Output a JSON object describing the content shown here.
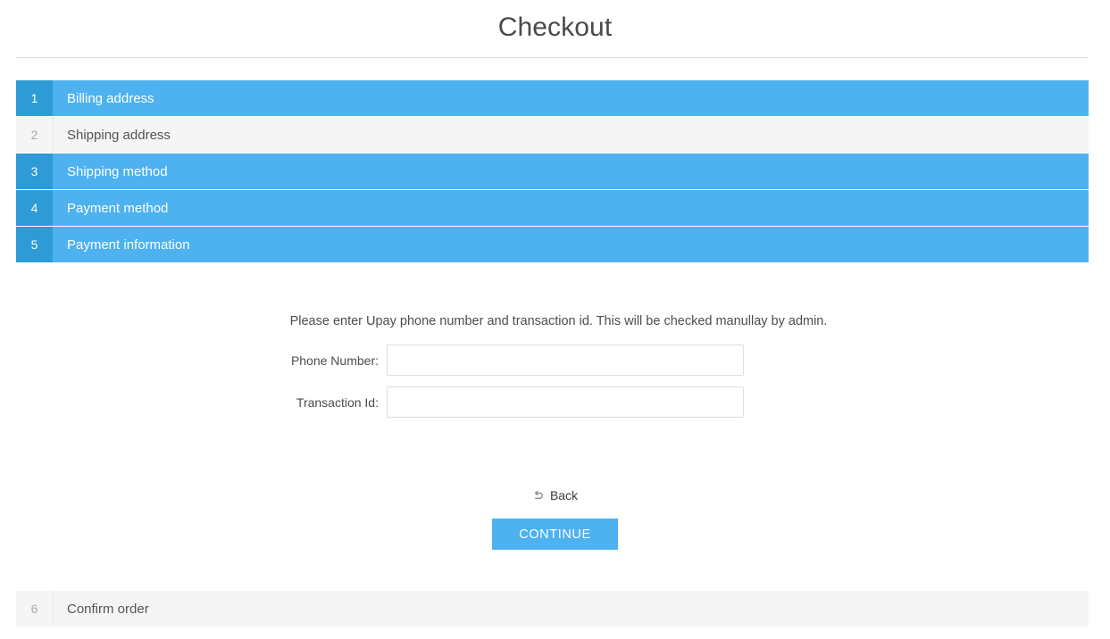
{
  "page": {
    "title": "Checkout"
  },
  "steps_top": [
    {
      "number": "1",
      "label": "Billing address",
      "state": "active"
    },
    {
      "number": "2",
      "label": "Shipping address",
      "state": "inactive"
    },
    {
      "number": "3",
      "label": "Shipping method",
      "state": "active"
    },
    {
      "number": "4",
      "label": "Payment method",
      "state": "active"
    },
    {
      "number": "5",
      "label": "Payment information",
      "state": "active"
    }
  ],
  "steps_bottom": [
    {
      "number": "6",
      "label": "Confirm order",
      "state": "inactive"
    }
  ],
  "payment_information": {
    "note": "Please enter Upay phone number and transaction id. This will be checked manullay by admin.",
    "fields": [
      {
        "label": "Phone Number:",
        "value": "",
        "placeholder": ""
      },
      {
        "label": "Transaction Id:",
        "value": "",
        "placeholder": ""
      }
    ]
  },
  "actions": {
    "back_label": "Back",
    "back_icon": "undo-arrow-icon",
    "continue_label": "CONTINUE"
  },
  "colors": {
    "accent": "#4db2ef",
    "accent_dark": "#2e9bd6",
    "inactive_bg": "#f5f5f5",
    "text": "#555555"
  }
}
